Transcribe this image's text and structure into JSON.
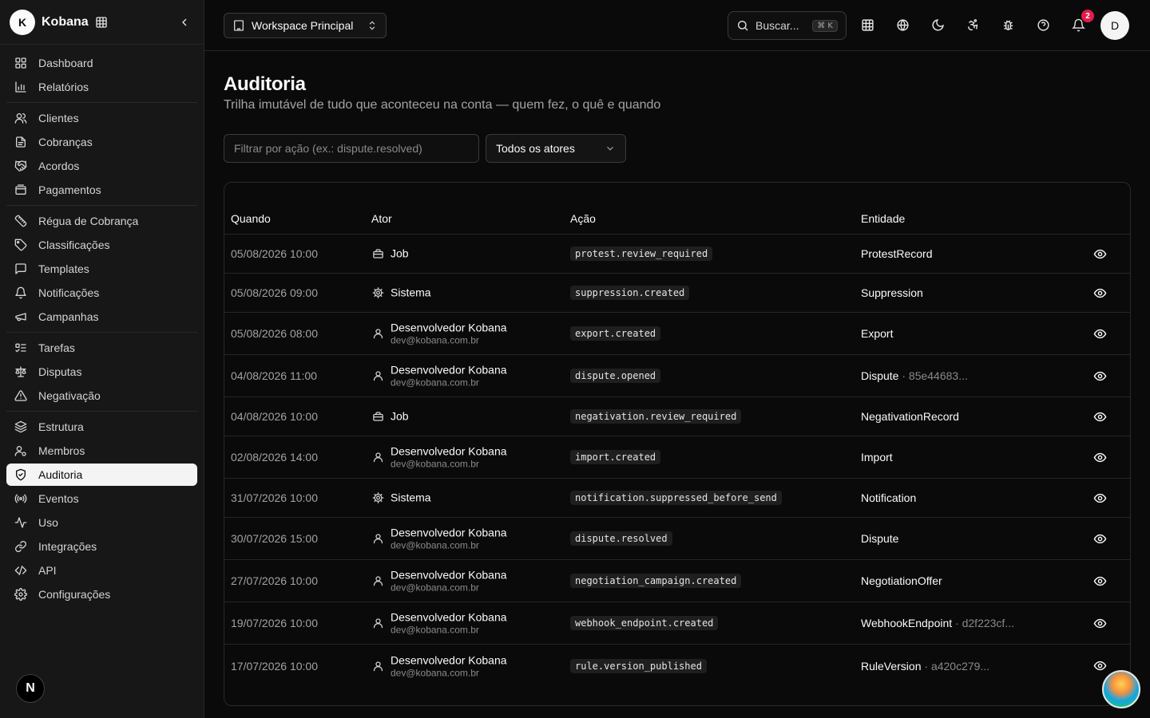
{
  "brand": {
    "logo": "K",
    "name": "Kobana"
  },
  "sidebar": {
    "groups": [
      [
        {
          "label": "Dashboard",
          "icon": "layout-grid-icon"
        },
        {
          "label": "Relatórios",
          "icon": "bar-chart-icon"
        }
      ],
      [
        {
          "label": "Clientes",
          "icon": "users-icon"
        },
        {
          "label": "Cobranças",
          "icon": "file-text-icon"
        },
        {
          "label": "Acordos",
          "icon": "handshake-icon"
        },
        {
          "label": "Pagamentos",
          "icon": "wallet-icon"
        }
      ],
      [
        {
          "label": "Régua de Cobrança",
          "icon": "ruler-icon"
        },
        {
          "label": "Classificações",
          "icon": "tag-icon"
        },
        {
          "label": "Templates",
          "icon": "message-square-icon"
        },
        {
          "label": "Notificações",
          "icon": "bell-icon"
        },
        {
          "label": "Campanhas",
          "icon": "megaphone-icon"
        }
      ],
      [
        {
          "label": "Tarefas",
          "icon": "list-todo-icon"
        },
        {
          "label": "Disputas",
          "icon": "scale-icon"
        },
        {
          "label": "Negativação",
          "icon": "alert-triangle-icon"
        }
      ],
      [
        {
          "label": "Estrutura",
          "icon": "layers-icon"
        },
        {
          "label": "Membros",
          "icon": "users-cog-icon"
        },
        {
          "label": "Auditoria",
          "icon": "shield-check-icon",
          "active": true
        },
        {
          "label": "Eventos",
          "icon": "radio-icon"
        },
        {
          "label": "Uso",
          "icon": "activity-icon"
        },
        {
          "label": "Integrações",
          "icon": "link-icon"
        },
        {
          "label": "API",
          "icon": "code-icon"
        },
        {
          "label": "Configurações",
          "icon": "settings-icon"
        }
      ]
    ],
    "footer_badge": "N"
  },
  "topbar": {
    "workspace": "Workspace Principal",
    "search_placeholder": "Buscar...",
    "search_shortcut": "⌘ K",
    "notification_count": "2",
    "avatar": "D"
  },
  "page": {
    "title": "Auditoria",
    "subtitle": "Trilha imutável de tudo que aconteceu na conta — quem fez, o quê e quando",
    "filter_placeholder": "Filtrar por ação (ex.: dispute.resolved)",
    "actor_filter": "Todos os atores"
  },
  "table": {
    "headers": {
      "when": "Quando",
      "actor": "Ator",
      "action": "Ação",
      "entity": "Entidade"
    },
    "rows": [
      {
        "when": "05/08/2026 10:00",
        "actor_type": "job",
        "actor": "Job",
        "email": "",
        "action": "protest.review_required",
        "entity": "ProtestRecord",
        "entity_id": ""
      },
      {
        "when": "05/08/2026 09:00",
        "actor_type": "system",
        "actor": "Sistema",
        "email": "",
        "action": "suppression.created",
        "entity": "Suppression",
        "entity_id": ""
      },
      {
        "when": "05/08/2026 08:00",
        "actor_type": "user",
        "actor": "Desenvolvedor Kobana",
        "email": "dev@kobana.com.br",
        "action": "export.created",
        "entity": "Export",
        "entity_id": ""
      },
      {
        "when": "04/08/2026 11:00",
        "actor_type": "user",
        "actor": "Desenvolvedor Kobana",
        "email": "dev@kobana.com.br",
        "action": "dispute.opened",
        "entity": "Dispute",
        "entity_id": "· 85e44683..."
      },
      {
        "when": "04/08/2026 10:00",
        "actor_type": "job",
        "actor": "Job",
        "email": "",
        "action": "negativation.review_required",
        "entity": "NegativationRecord",
        "entity_id": ""
      },
      {
        "when": "02/08/2026 14:00",
        "actor_type": "user",
        "actor": "Desenvolvedor Kobana",
        "email": "dev@kobana.com.br",
        "action": "import.created",
        "entity": "Import",
        "entity_id": ""
      },
      {
        "when": "31/07/2026 10:00",
        "actor_type": "system",
        "actor": "Sistema",
        "email": "",
        "action": "notification.suppressed_before_send",
        "entity": "Notification",
        "entity_id": ""
      },
      {
        "when": "30/07/2026 15:00",
        "actor_type": "user",
        "actor": "Desenvolvedor Kobana",
        "email": "dev@kobana.com.br",
        "action": "dispute.resolved",
        "entity": "Dispute",
        "entity_id": ""
      },
      {
        "when": "27/07/2026 10:00",
        "actor_type": "user",
        "actor": "Desenvolvedor Kobana",
        "email": "dev@kobana.com.br",
        "action": "negotiation_campaign.created",
        "entity": "NegotiationOffer",
        "entity_id": ""
      },
      {
        "when": "19/07/2026 10:00",
        "actor_type": "user",
        "actor": "Desenvolvedor Kobana",
        "email": "dev@kobana.com.br",
        "action": "webhook_endpoint.created",
        "entity": "WebhookEndpoint",
        "entity_id": "· d2f223cf..."
      },
      {
        "when": "17/07/2026 10:00",
        "actor_type": "user",
        "actor": "Desenvolvedor Kobana",
        "email": "dev@kobana.com.br",
        "action": "rule.version_published",
        "entity": "RuleVersion",
        "entity_id": "· a420c279..."
      }
    ]
  },
  "colors": {
    "background": "#0a0a0a",
    "sidebar": "#171717",
    "active_item": "#f4f4f5",
    "notification": "#e11d48"
  }
}
